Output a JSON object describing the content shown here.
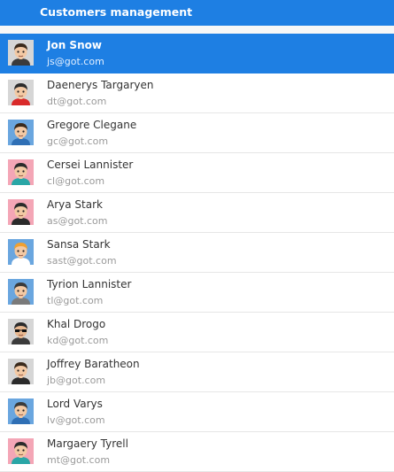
{
  "header": {
    "title": "Customers management"
  },
  "customers": [
    {
      "name": "Jon Snow",
      "email": "js@got.com",
      "selected": true,
      "avatar_bg": "#d6d6d6",
      "hair": "#3a2a1c",
      "skin": "#f3c9a4",
      "shirt": "#3b3b3b",
      "glasses": false
    },
    {
      "name": "Daenerys Targaryen",
      "email": "dt@got.com",
      "selected": false,
      "avatar_bg": "#d6d6d6",
      "hair": "#2b2b2b",
      "skin": "#f3c9a4",
      "shirt": "#d92a2a",
      "glasses": false
    },
    {
      "name": "Gregore Clegane",
      "email": "gc@got.com",
      "selected": false,
      "avatar_bg": "#6aa6df",
      "hair": "#3a2a1c",
      "skin": "#f3c9a4",
      "shirt": "#2f6fb5",
      "glasses": false
    },
    {
      "name": "Cersei Lannister",
      "email": "cl@got.com",
      "selected": false,
      "avatar_bg": "#f4a6b6",
      "hair": "#2b2b2b",
      "skin": "#f3c9a4",
      "shirt": "#2aa6a6",
      "glasses": false
    },
    {
      "name": "Arya Stark",
      "email": "as@got.com",
      "selected": false,
      "avatar_bg": "#f4a6b6",
      "hair": "#2b2b2b",
      "skin": "#f3c9a4",
      "shirt": "#2b2b2b",
      "glasses": false
    },
    {
      "name": "Sansa Stark",
      "email": "sast@got.com",
      "selected": false,
      "avatar_bg": "#6aa6df",
      "hair": "#f0a030",
      "skin": "#f3c9a4",
      "shirt": "#ffffff",
      "glasses": false
    },
    {
      "name": "Tyrion Lannister",
      "email": "tl@got.com",
      "selected": false,
      "avatar_bg": "#6aa6df",
      "hair": "#3a3a3a",
      "skin": "#f3c9a4",
      "shirt": "#7a7a7a",
      "glasses": false
    },
    {
      "name": "Khal Drogo",
      "email": "kd@got.com",
      "selected": false,
      "avatar_bg": "#d6d6d6",
      "hair": "#2b2b2b",
      "skin": "#e8b890",
      "shirt": "#3b3b3b",
      "glasses": true
    },
    {
      "name": "Joffrey Baratheon",
      "email": "jb@got.com",
      "selected": false,
      "avatar_bg": "#d6d6d6",
      "hair": "#3a2a1c",
      "skin": "#f3c9a4",
      "shirt": "#2b2b2b",
      "glasses": false
    },
    {
      "name": "Lord Varys",
      "email": "lv@got.com",
      "selected": false,
      "avatar_bg": "#6aa6df",
      "hair": "#3a3a3a",
      "skin": "#f3c9a4",
      "shirt": "#2f6fb5",
      "glasses": false
    },
    {
      "name": "Margaery Tyrell",
      "email": "mt@got.com",
      "selected": false,
      "avatar_bg": "#f4a6b6",
      "hair": "#2b2b2b",
      "skin": "#f3c9a4",
      "shirt": "#2aa6a6",
      "glasses": false
    }
  ]
}
